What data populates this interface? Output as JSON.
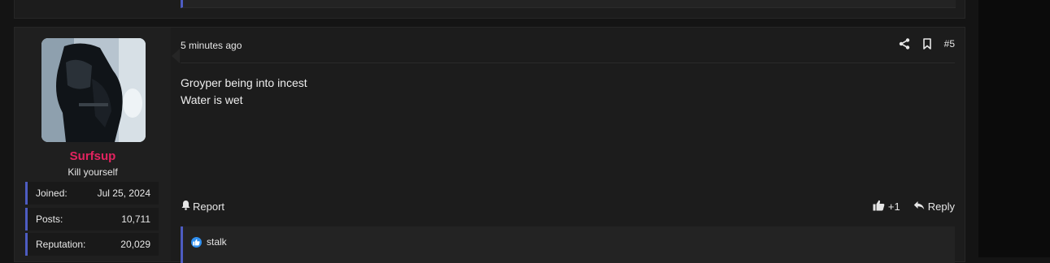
{
  "post": {
    "timestamp": "5 minutes ago",
    "number": "#5",
    "body_lines": [
      "Groyper being into incest",
      "Water is wet"
    ],
    "report_label": "Report",
    "like_count": "+1",
    "reply_label": "Reply",
    "reactors": "stalk"
  },
  "user": {
    "name": "Surfsup",
    "title": "Kill yourself",
    "stats": [
      {
        "label": "Joined:",
        "value": "Jul 25, 2024"
      },
      {
        "label": "Posts:",
        "value": "10,711"
      },
      {
        "label": "Reputation:",
        "value": "20,029"
      }
    ]
  },
  "colors": {
    "username": "#e3235f",
    "accent_border": "#4d5cc2",
    "like_badge": "#2f8fef"
  },
  "icons": [
    "share-icon",
    "bookmark-icon",
    "bell-icon",
    "thumbs-up-icon",
    "reply-arrow-icon",
    "like-reaction-icon"
  ]
}
